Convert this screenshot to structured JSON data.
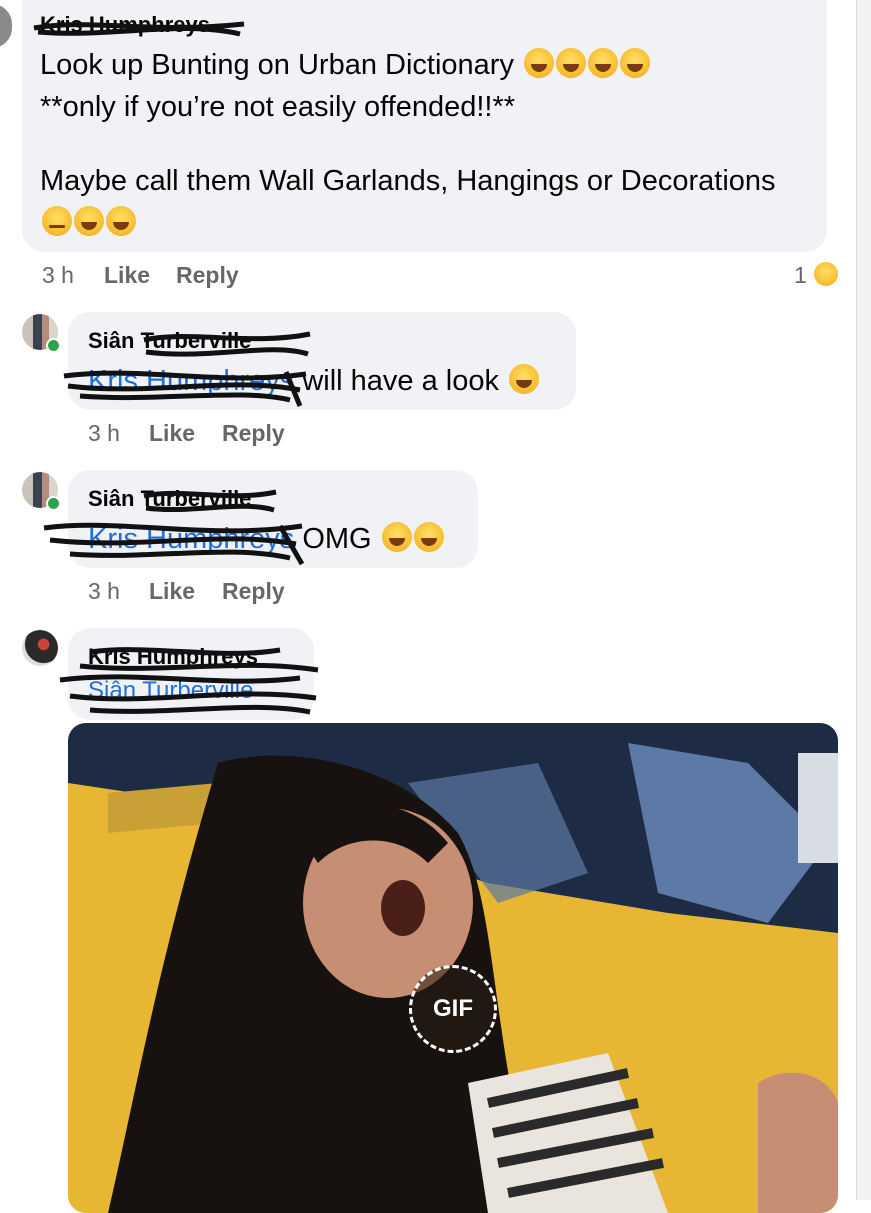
{
  "comments": [
    {
      "author": "Kris Humphreys",
      "lines": [
        "Look up Bunting on Urban Dictionary",
        "**only if you’re not easily offended!!**",
        "",
        "Maybe call them Wall Garlands, Hangings or Decorations"
      ],
      "time": "3 h",
      "like": "Like",
      "reply": "Reply",
      "reaction_count": "1",
      "reaction_icon": "yum-face-icon"
    },
    {
      "author": "Siân Turberville",
      "mention": "Kris Humphreys",
      "text": " will have a look",
      "time": "3 h",
      "like": "Like",
      "reply": "Reply"
    },
    {
      "author": "Siân Turberville",
      "mention": "Kris Humphreys",
      "text": " OMG",
      "time": "3 h",
      "like": "Like",
      "reply": "Reply"
    },
    {
      "author": "Kris Humphreys",
      "mention": "Siân Turberville",
      "gif_label": "GIF"
    }
  ],
  "colors": {
    "bubble": "#f0f2f5",
    "mention": "#216fdb",
    "meta": "#65676b",
    "online": "#31a24c",
    "gif_background": "#e7b632"
  }
}
